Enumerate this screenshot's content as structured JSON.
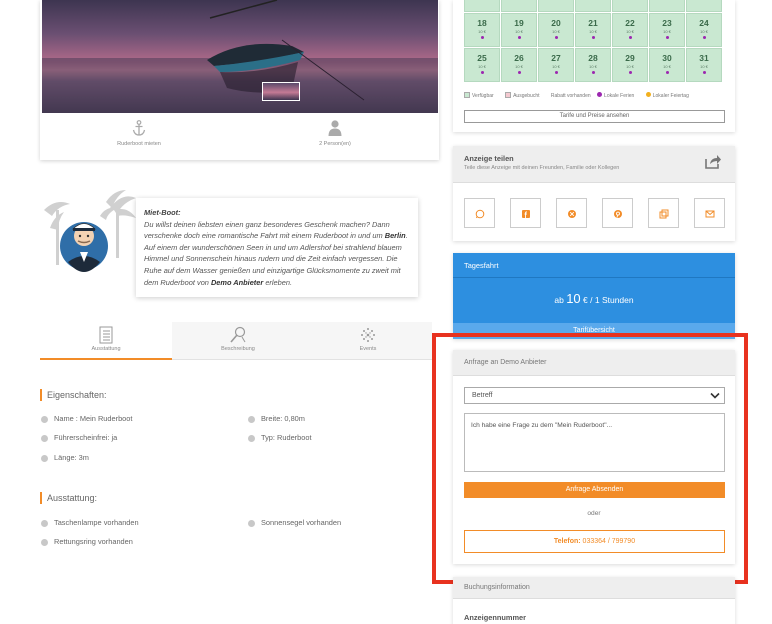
{
  "listing": {
    "features": [
      {
        "icon": "anchor-icon",
        "label": "Ruderboot mieten"
      },
      {
        "icon": "person-icon",
        "label": "2 Person(en)"
      }
    ]
  },
  "description": {
    "title": "Miet-Boot:",
    "part1": "Du willst deinen liebsten einen ganz besonderes Geschenk machen? Dann verschenke doch eine romantische Fahrt mit einem Ruderboot in und um ",
    "city": "Berlin",
    "part2": ". Auf einem der wunderschönen Seen in und um Adlershof bei strahlend blauem Himmel und Sonnenschein hinaus rudern und die Zeit einfach vergessen. Die Ruhe auf dem Wasser genießen und einzigartige Glücksmomente zu zweit mit dem Ruderboot von ",
    "provider": "Demo Anbieter",
    "part3": " erleben."
  },
  "tabs": [
    {
      "label": "Ausstattung",
      "icon": "checklist-icon",
      "active": true
    },
    {
      "label": "Beschreibung",
      "icon": "pen-icon",
      "active": false
    },
    {
      "label": "Events",
      "icon": "fireworks-icon",
      "active": false
    }
  ],
  "properties": {
    "title": "Eigenschaften:",
    "items": [
      "Name : Mein Ruderboot",
      "Breite: 0,80m",
      "Führerscheinfrei: ja",
      "Typ: Ruderboot",
      "Länge: 3m"
    ]
  },
  "equipment": {
    "title": "Ausstattung:",
    "items": [
      "Taschenlampe vorhanden",
      "Sonnensegel vorhanden",
      "Rettungsring vorhanden"
    ]
  },
  "calendar": {
    "rows": [
      {
        "days": [
          "18",
          "19",
          "20",
          "21",
          "22",
          "23",
          "24"
        ]
      },
      {
        "days": [
          "25",
          "26",
          "27",
          "28",
          "29",
          "30",
          "31"
        ]
      }
    ],
    "price_tag": "10 €",
    "legend": {
      "available": "Verfügbar",
      "booked": "Ausgebucht",
      "discount": "Rabatt vorhanden",
      "holidays": "Lokale Ferien",
      "holiday": "Lokaler Feiertag"
    },
    "colors": {
      "available": "#c9e8d1",
      "booked": "#f4c9d0",
      "holidays": "#9c27b0",
      "holiday": "#f2b01e"
    },
    "tarif_button": "Tarife und Preise ansehen"
  },
  "share": {
    "title": "Anzeige teilen",
    "subtitle": "Teile diese Anzeige mit deinen Freunden, Familie oder Kollegen",
    "buttons": [
      "whatsapp-icon",
      "facebook-icon",
      "xing-icon",
      "pinterest-icon",
      "copy-icon",
      "mail-icon"
    ]
  },
  "trip": {
    "title": "Tagesfahrt",
    "price_prefix": "ab",
    "price_value": "10",
    "price_suffix": "€ / 1 Stunden",
    "link": "Tarifübersicht"
  },
  "inquiry": {
    "title": "Anfrage an Demo Anbieter",
    "subject_value": "Betreff",
    "message": "Ich habe eine Frage zu dem \"Mein Ruderboot\"...",
    "send_button": "Anfrage Absenden",
    "or": "oder",
    "phone_label": "Telefon:",
    "phone_number": "033364 / 799790"
  },
  "booking": {
    "title": "Buchungsinformation",
    "row": "Anzeigennummer"
  }
}
